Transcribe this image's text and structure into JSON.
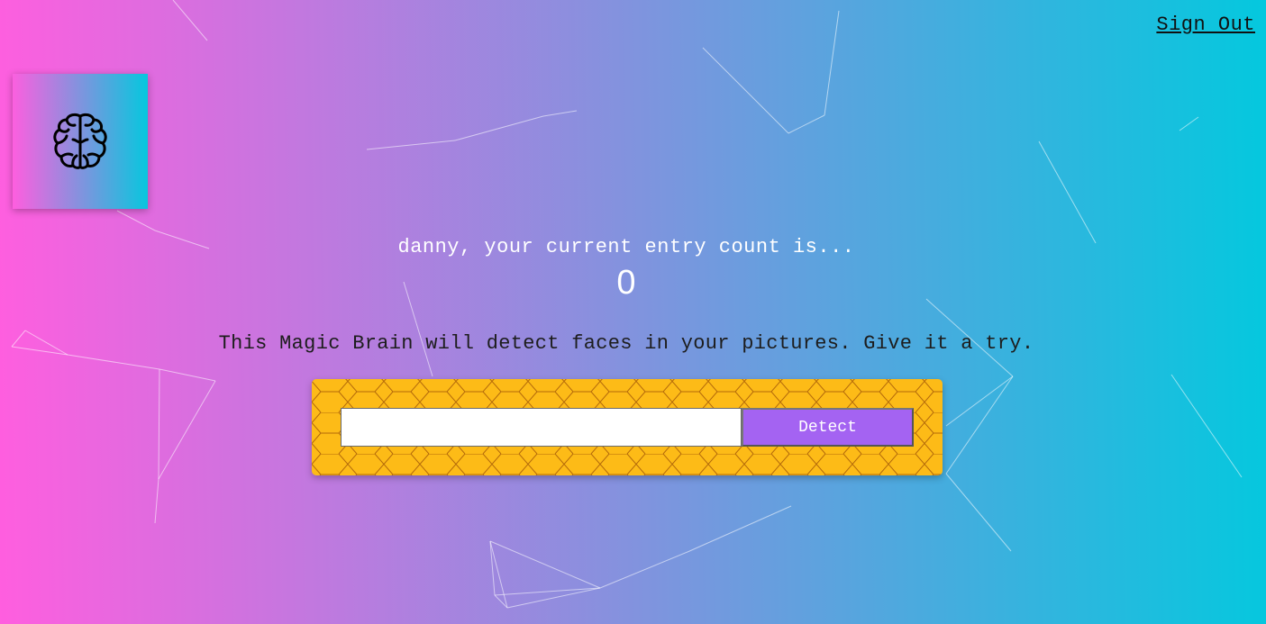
{
  "nav": {
    "signout_label": "Sign Out"
  },
  "logo": {
    "icon": "brain-icon"
  },
  "rank": {
    "title": "danny, your current entry count is...",
    "count": "0"
  },
  "intro": {
    "text": "This Magic Brain will detect faces in your pictures. Give it a try."
  },
  "image_form": {
    "url_input_value": "",
    "detect_label": "Detect"
  },
  "colors": {
    "gradient_start": "#ff5edf",
    "gradient_end": "#04c8de",
    "panel_fill": "#fdbb17",
    "button_fill": "#a463f2"
  }
}
